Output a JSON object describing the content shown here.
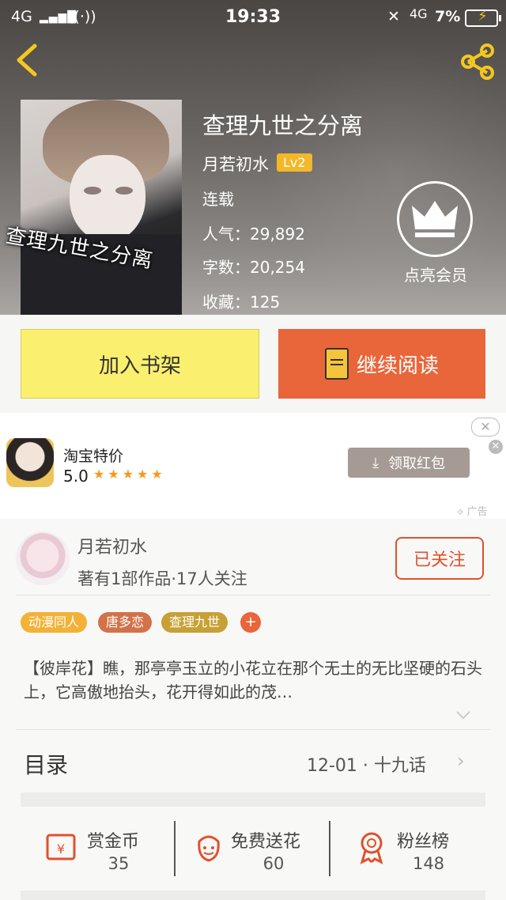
{
  "status_bar": {
    "left": "4G",
    "time": "19:33",
    "network": "4G",
    "battery": "7%"
  },
  "book": {
    "title": "查理九世之分离",
    "cover_text": "查理九世之分离",
    "author": "月若初水",
    "author_level": "Lv2",
    "status": "连载",
    "popularity_label": "人气：29,892",
    "word_count_label": "字数：20,254",
    "favorites_label": "收藏：125"
  },
  "vip": {
    "label": "点亮会员"
  },
  "actions": {
    "add_shelf": "加入书架",
    "continue_read": "继续阅读"
  },
  "ad": {
    "name": "淘宝特价",
    "rating": "5.0",
    "stars": "★★★★★",
    "button": "领取红包",
    "close_symbol": "✕",
    "mark": "广告"
  },
  "author_card": {
    "name": "月若初水",
    "stats": "著有1部作品·17人关注",
    "follow_label": "已关注"
  },
  "tags": [
    {
      "label": "动漫同人",
      "color": "#f3b236"
    },
    {
      "label": "唐多恋",
      "color": "#d2724a"
    },
    {
      "label": "查理九世",
      "color": "#c7a135"
    }
  ],
  "tag_add": "+",
  "description": "【彼岸花】瞧，那亭亭玉立的小花立在那个无土的无比坚硬的石头上，它高傲地抬头，花开得如此的茂…",
  "toc": {
    "label": "目录",
    "latest": "12-01 · 十九话",
    "arrow": "›"
  },
  "stats": [
    {
      "label": "赏金币",
      "value": "35",
      "icon": "reward-coin-icon"
    },
    {
      "label": "免费送花",
      "value": "60",
      "icon": "flower-icon"
    },
    {
      "label": "粉丝榜",
      "value": "148",
      "icon": "ribbon-medal-icon"
    }
  ],
  "colors": {
    "accent": "#e9653a",
    "shelf_button": "#fbef6f",
    "level_badge": "#f3b624"
  }
}
